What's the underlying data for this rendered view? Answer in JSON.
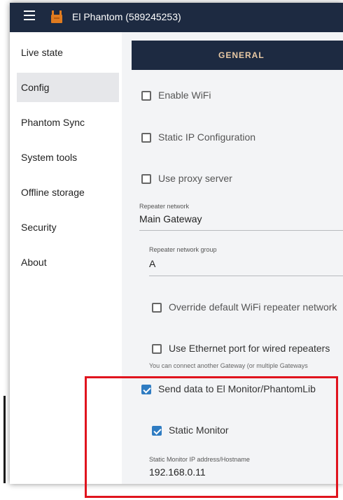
{
  "header": {
    "title": "El Phantom (589245253)",
    "menu_icon": "hamburger-icon",
    "logo_icon": "phantom-logo-icon"
  },
  "sidebar": {
    "items": [
      {
        "label": "Live state"
      },
      {
        "label": "Config",
        "active": true
      },
      {
        "label": "Phantom Sync"
      },
      {
        "label": "System tools"
      },
      {
        "label": "Offline storage"
      },
      {
        "label": "Security"
      },
      {
        "label": "About"
      }
    ]
  },
  "tab": {
    "label": "GENERAL"
  },
  "settings": {
    "enable_wifi": {
      "label": "Enable WiFi",
      "checked": false
    },
    "static_ip": {
      "label": "Static IP Configuration",
      "checked": false
    },
    "proxy": {
      "label": "Use proxy server",
      "checked": false
    },
    "repeater_network": {
      "label": "Repeater network",
      "value": "Main Gateway"
    },
    "repeater_group": {
      "label": "Repeater network group",
      "value": "A"
    },
    "override_wifi": {
      "label": "Override default WiFi repeater network",
      "checked": false
    },
    "ethernet": {
      "label": "Use Ethernet port for wired repeaters",
      "checked": false,
      "helper": "You can connect another Gateway (or multiple Gateways"
    },
    "send_data": {
      "label": "Send data to El Monitor/PhantomLib",
      "checked": true
    },
    "static_monitor": {
      "label": "Static Monitor",
      "checked": true
    },
    "monitor_address": {
      "label": "Static Monitor IP address/Hostname",
      "value": "192.168.0.11"
    }
  },
  "colors": {
    "header_bg": "#1d2a41",
    "tab_text": "#e9c9a4",
    "checkbox_checked": "#2f7cc2",
    "highlight": "#e0141e",
    "logo": "#e07b1f"
  }
}
